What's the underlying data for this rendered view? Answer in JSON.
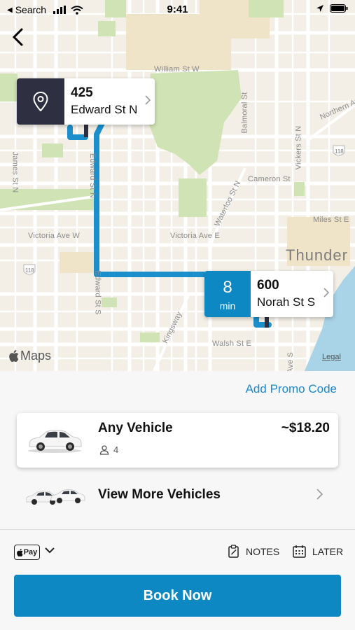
{
  "status_bar": {
    "back_app": "Search",
    "time": "9:41"
  },
  "map": {
    "streets": [
      {
        "name": "William St W"
      },
      {
        "name": "Northern Av"
      },
      {
        "name": "James St N"
      },
      {
        "name": "Edward St N"
      },
      {
        "name": "Balmoral St"
      },
      {
        "name": "Vickers St N"
      },
      {
        "name": "Cameron St"
      },
      {
        "name": "Waterloo St N"
      },
      {
        "name": "Miles St E"
      },
      {
        "name": "Victoria Ave W"
      },
      {
        "name": "Victoria Ave E"
      },
      {
        "name": "Edward St S"
      },
      {
        "name": "Kingsway"
      },
      {
        "name": "Walsh St E"
      },
      {
        "name": "Ave S"
      }
    ],
    "city": "Thunder",
    "highway_shields": [
      "118",
      "118"
    ],
    "maps_label": "Maps",
    "legal_label": "Legal"
  },
  "pickup": {
    "number": "425",
    "street": "Edward St N"
  },
  "dropoff": {
    "eta_value": "8",
    "eta_unit": "min",
    "number": "600",
    "street": "Norah St S"
  },
  "sheet": {
    "promo_label": "Add Promo Code",
    "vehicle": {
      "name": "Any Vehicle",
      "seats": "4",
      "price": "~$18.20"
    },
    "more_vehicles_label": "View More Vehicles",
    "payment": "Pay",
    "notes_label": "NOTES",
    "later_label": "LATER",
    "book_label": "Book Now"
  },
  "colors": {
    "accent": "#0d88c2",
    "route": "#1a8fcb",
    "pickup_box": "#2e2f41",
    "promo_link": "#1b88cf",
    "map_bg": "#f3efe6",
    "park": "#cfe3b5"
  }
}
